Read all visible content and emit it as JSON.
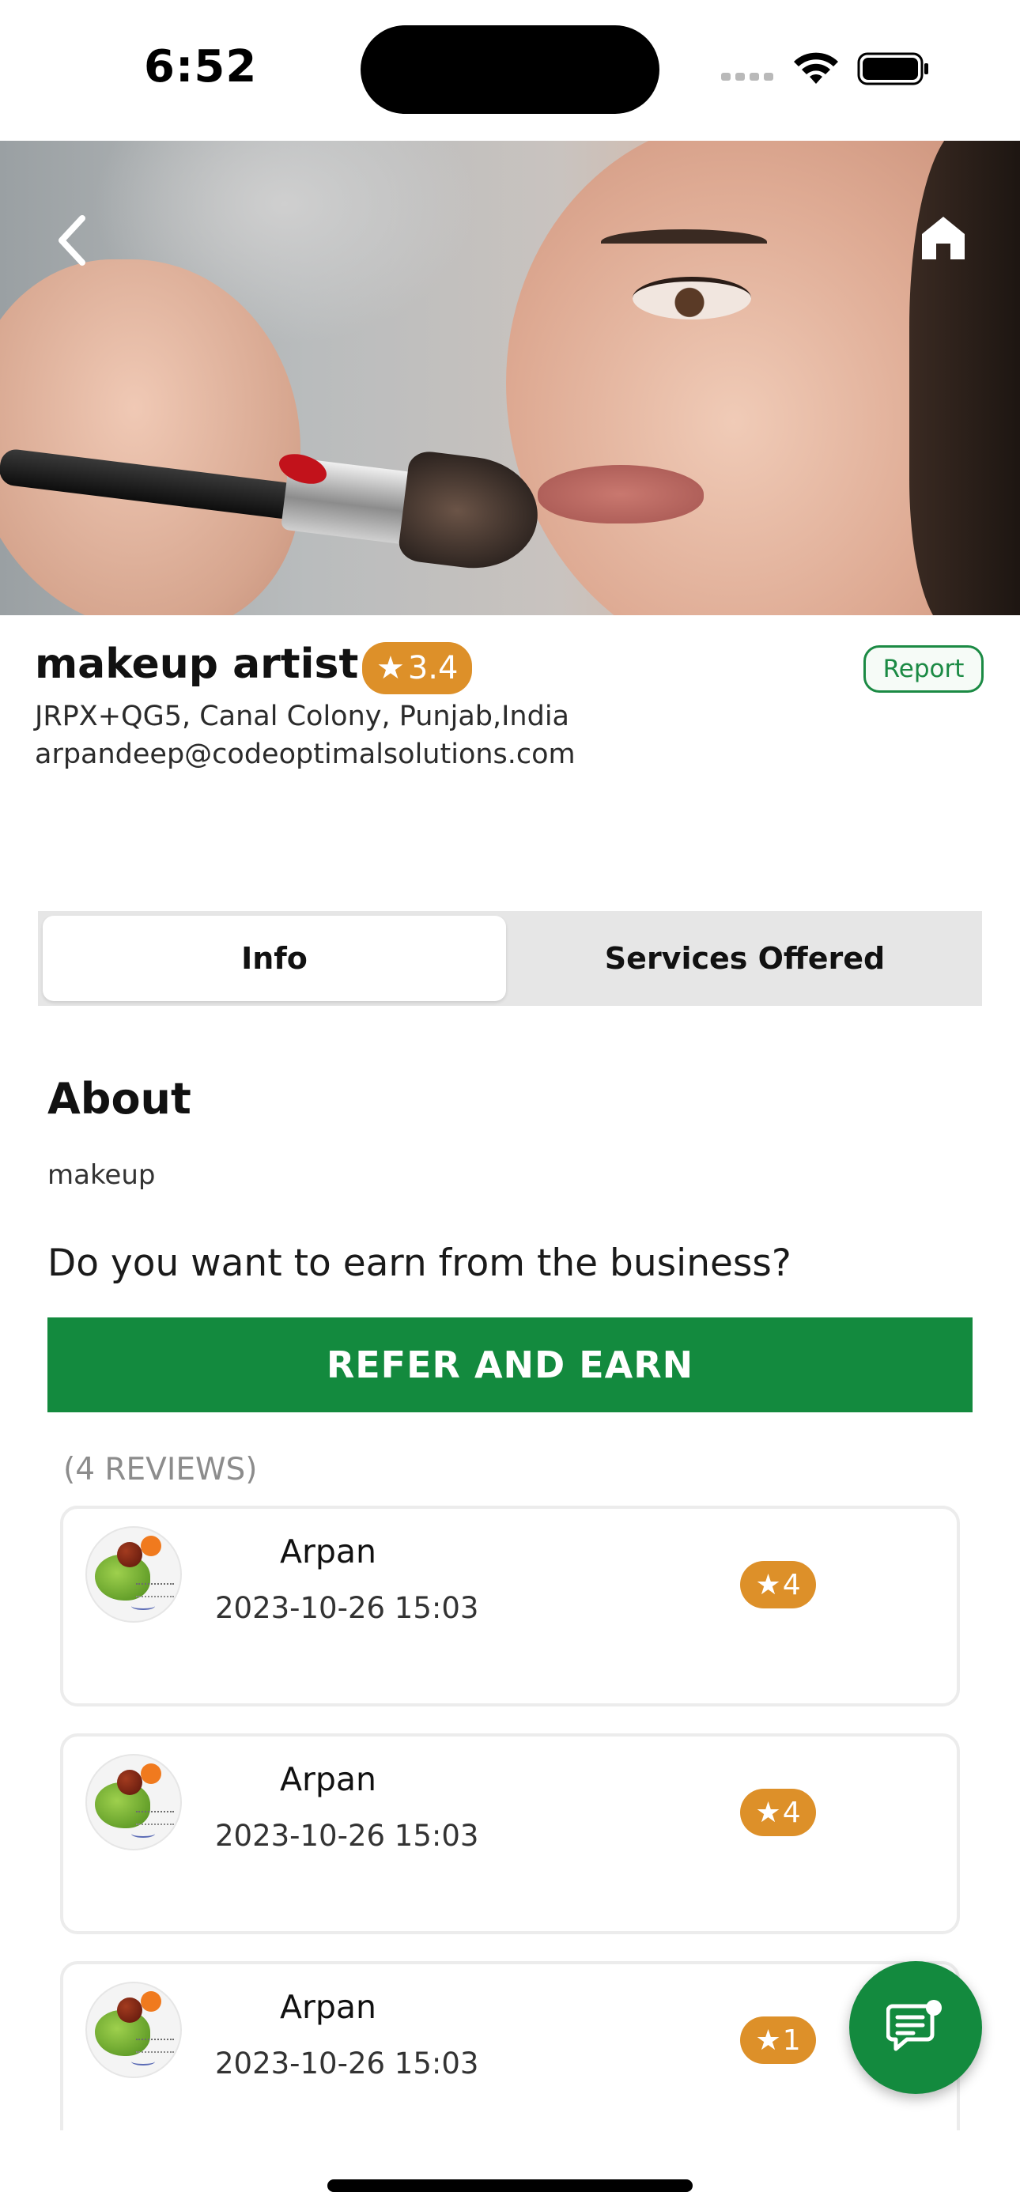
{
  "status_bar": {
    "time": "6:52"
  },
  "hero": {
    "icons": {
      "back": "chevron-left-icon",
      "home": "home-icon"
    }
  },
  "business": {
    "name": "makeup artist",
    "rating": "3.4",
    "report_label": "Report",
    "address": "JRPX+QG5, Canal Colony, Punjab,India",
    "email": "arpandeep@codeoptimalsolutions.com"
  },
  "tabs": [
    {
      "label": "Info",
      "selected": true
    },
    {
      "label": "Services Offered",
      "selected": false
    }
  ],
  "about": {
    "title": "About",
    "text": "makeup"
  },
  "earn": {
    "question": "Do you want to earn from the business?",
    "button_label": "REFER AND EARN"
  },
  "reviews": {
    "count_label": "(4 REVIEWS)",
    "items": [
      {
        "name": "Arpan",
        "date": "2023-10-26 15:03",
        "rating": "4"
      },
      {
        "name": "Arpan",
        "date": "2023-10-26 15:03",
        "rating": "4"
      },
      {
        "name": "Arpan",
        "date": "2023-10-26 15:03",
        "rating": "1"
      }
    ]
  },
  "colors": {
    "primary_green": "#138a3e",
    "rating_orange": "#dd9029",
    "tab_bg": "#e6e6e6"
  },
  "fab": {
    "icon": "chat-icon"
  }
}
